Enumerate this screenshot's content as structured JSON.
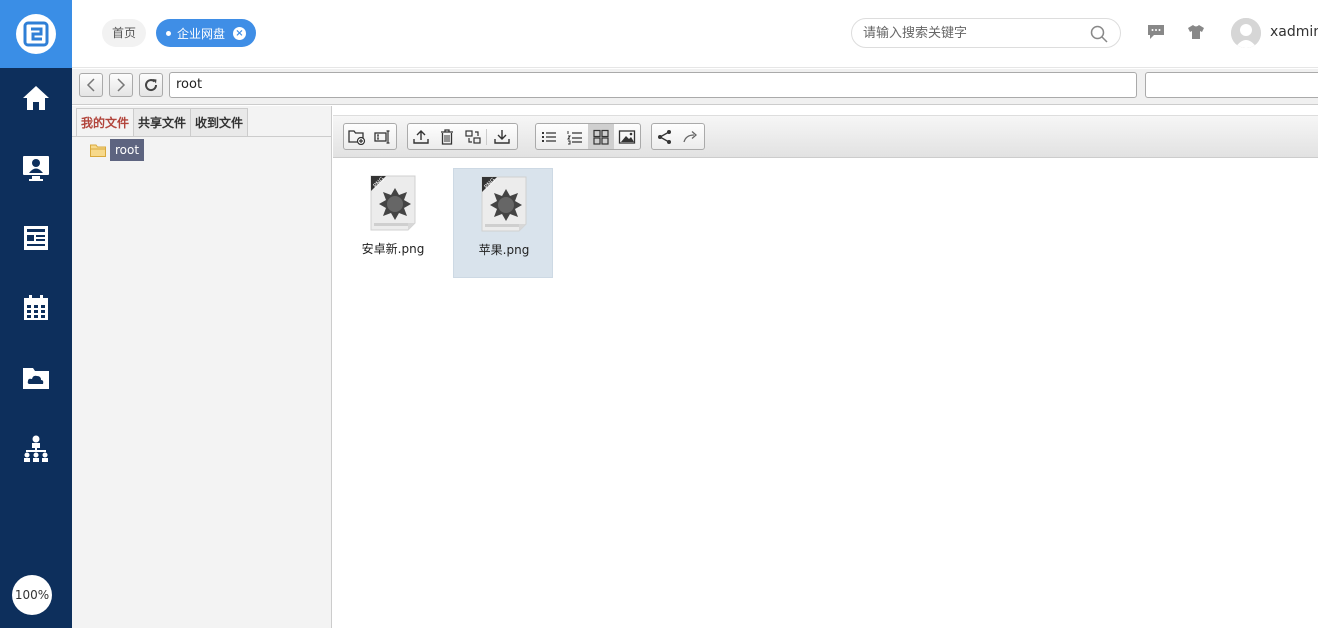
{
  "sidebar": {
    "logo_icon": "app-logo-icon",
    "items": [
      {
        "icon": "home-icon"
      },
      {
        "icon": "monitor-user-icon"
      },
      {
        "icon": "newspaper-icon"
      },
      {
        "icon": "calendar-icon"
      },
      {
        "icon": "cloud-folder-icon"
      },
      {
        "icon": "org-chart-icon"
      }
    ],
    "zoom": "100%"
  },
  "header": {
    "tabs": [
      {
        "label": "首页"
      },
      {
        "label": "企业网盘"
      }
    ],
    "search_placeholder": "请输入搜索关键字",
    "username": "xadmin"
  },
  "pathbar": {
    "path": "root",
    "filter_value": ""
  },
  "left_panel": {
    "tabs": [
      "我的文件",
      "共享文件",
      "收到文件"
    ],
    "active_tab": "我的文件",
    "tree_root": "root"
  },
  "files": [
    {
      "name": "安卓新.png",
      "type": "PNG",
      "selected": false
    },
    {
      "name": "苹果.png",
      "type": "PNG",
      "selected": true
    }
  ],
  "colors": {
    "sidebar": "#0d2f5c",
    "accent": "#3f8ee6",
    "active_tab_text": "#b2453c",
    "selection": "#d9e3ec"
  }
}
